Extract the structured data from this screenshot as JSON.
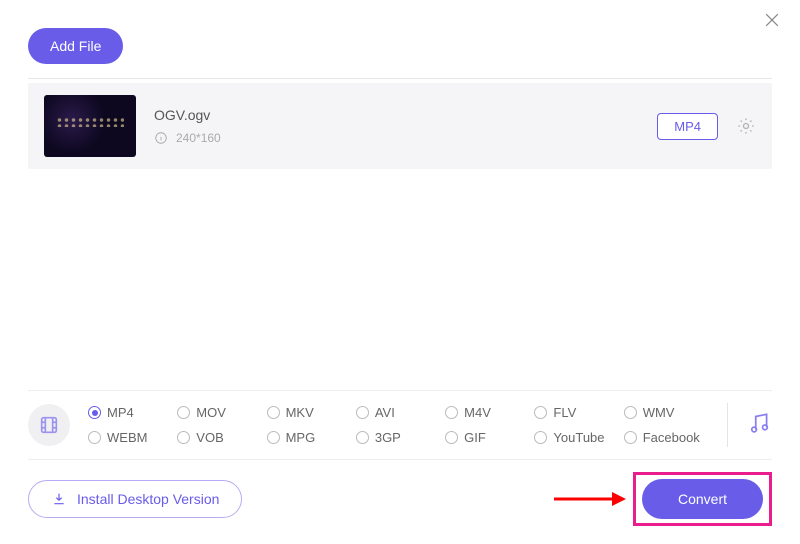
{
  "header": {
    "add_file_label": "Add File"
  },
  "file": {
    "name": "OGV.ogv",
    "resolution": "240*160",
    "format_button": "MP4"
  },
  "formats": {
    "selected": "MP4",
    "items": [
      "MP4",
      "MOV",
      "MKV",
      "AVI",
      "M4V",
      "FLV",
      "WMV",
      "WEBM",
      "VOB",
      "MPG",
      "3GP",
      "GIF",
      "YouTube",
      "Facebook"
    ]
  },
  "footer": {
    "install_label": "Install Desktop Version",
    "convert_label": "Convert"
  },
  "colors": {
    "accent": "#685ce9",
    "highlight_border": "#e91e8c",
    "arrow": "#ff0000"
  }
}
